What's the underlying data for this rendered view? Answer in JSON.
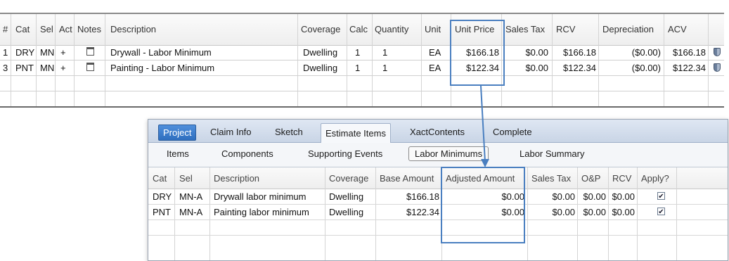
{
  "top_grid": {
    "headers": {
      "num": "#",
      "cat": "Cat",
      "sel": "Sel",
      "act": "Act",
      "notes": "Notes",
      "description": "Description",
      "coverage": "Coverage",
      "calc": "Calc",
      "quantity": "Quantity",
      "unit": "Unit",
      "unit_price": "Unit Price",
      "sales_tax": "Sales Tax",
      "rcv": "RCV",
      "depreciation": "Depreciation",
      "acv": "ACV"
    },
    "rows": [
      {
        "num": "1",
        "cat": "DRY",
        "sel": "MN",
        "act": "+",
        "description": "Drywall - Labor Minimum",
        "coverage": "Dwelling",
        "calc": "1",
        "quantity": "1",
        "unit": "EA",
        "unit_price": "$166.18",
        "sales_tax": "$0.00",
        "rcv": "$166.18",
        "depreciation": "($0.00)",
        "acv": "$166.18",
        "notes_icon": "notes-icon",
        "status_icon": "shield-icon"
      },
      {
        "num": "3",
        "cat": "PNT",
        "sel": "MN",
        "act": "+",
        "description": "Painting - Labor Minimum",
        "coverage": "Dwelling",
        "calc": "1",
        "quantity": "1",
        "unit": "EA",
        "unit_price": "$122.34",
        "sales_tax": "$0.00",
        "rcv": "$122.34",
        "depreciation": "($0.00)",
        "acv": "$122.34",
        "notes_icon": "notes-icon",
        "status_icon": "shield-icon"
      }
    ]
  },
  "panel": {
    "tabs": [
      "Project",
      "Claim Info",
      "Sketch",
      "Estimate Items",
      "XactContents",
      "Complete"
    ],
    "active_tab": "Estimate Items",
    "subtabs": [
      "Items",
      "Components",
      "Supporting Events",
      "Labor Minimums",
      "Labor Summary"
    ],
    "active_subtab": "Labor Minimums",
    "headers": {
      "cat": "Cat",
      "sel": "Sel",
      "description": "Description",
      "coverage": "Coverage",
      "base_amount": "Base Amount",
      "adjusted_amount": "Adjusted Amount",
      "sales_tax": "Sales Tax",
      "op": "O&P",
      "rcv": "RCV",
      "apply": "Apply?"
    },
    "rows": [
      {
        "cat": "DRY",
        "sel": "MN-A",
        "description": "Drywall labor minimum",
        "coverage": "Dwelling",
        "base_amount": "$166.18",
        "adjusted_amount": "$0.00",
        "sales_tax": "$0.00",
        "op": "$0.00",
        "rcv": "$0.00",
        "apply": true
      },
      {
        "cat": "PNT",
        "sel": "MN-A",
        "description": "Painting labor minimum",
        "coverage": "Dwelling",
        "base_amount": "$122.34",
        "adjusted_amount": "$0.00",
        "sales_tax": "$0.00",
        "op": "$0.00",
        "rcv": "$0.00",
        "apply": true
      }
    ]
  },
  "colors": {
    "highlight": "#4a7fc0",
    "tab_active_blue": "#2f6fbf",
    "tab_bar": "#c9d5e6"
  }
}
